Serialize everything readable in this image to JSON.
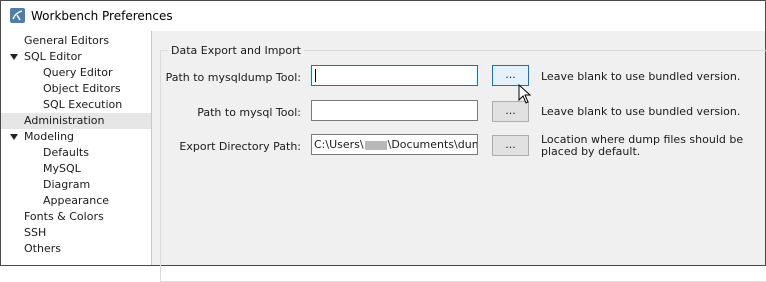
{
  "window": {
    "title": "Workbench Preferences"
  },
  "sidebar": {
    "items": [
      {
        "label": "General Editors"
      },
      {
        "label": "SQL Editor"
      },
      {
        "label": "Query Editor"
      },
      {
        "label": "Object Editors"
      },
      {
        "label": "SQL Execution"
      },
      {
        "label": "Administration"
      },
      {
        "label": "Modeling"
      },
      {
        "label": "Defaults"
      },
      {
        "label": "MySQL"
      },
      {
        "label": "Diagram"
      },
      {
        "label": "Appearance"
      },
      {
        "label": "Fonts & Colors"
      },
      {
        "label": "SSH"
      },
      {
        "label": "Others"
      }
    ],
    "selected": "Administration"
  },
  "group": {
    "title": "Data Export and Import",
    "rows": [
      {
        "label": "Path to mysqldump Tool:",
        "value": "",
        "button": "...",
        "hint": "Leave blank to use bundled version."
      },
      {
        "label": "Path to mysql Tool:",
        "value": "",
        "button": "...",
        "hint": "Leave blank to use bundled version."
      },
      {
        "label": "Export Directory Path:",
        "value_prefix": "C:\\Users\\",
        "value_suffix": "\\Documents\\dumps",
        "button": "...",
        "hint": "Location where dump files should be placed by default."
      }
    ]
  },
  "colors": {
    "accent": "#0078d7",
    "selection": "#e6e6e6"
  }
}
